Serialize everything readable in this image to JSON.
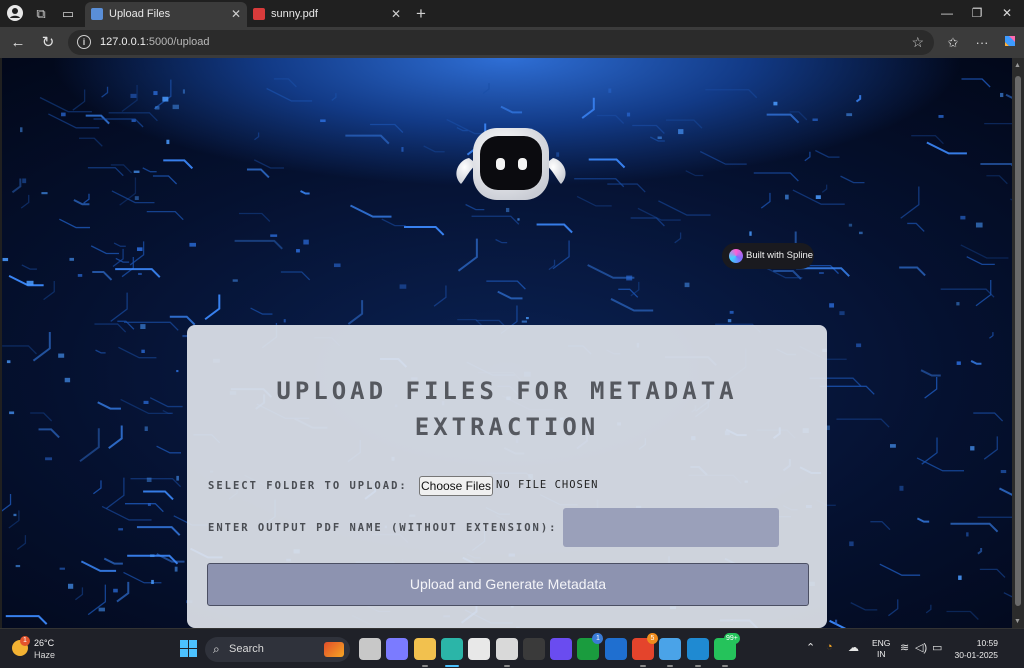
{
  "browser": {
    "tabs": [
      {
        "title": "Upload Files",
        "active": true
      },
      {
        "title": "sunny.pdf",
        "active": false
      }
    ],
    "url": {
      "host": "127.0.0.1",
      "path": ":5000/upload"
    }
  },
  "page": {
    "badge": "Built with Spline",
    "card": {
      "title": "UPLOAD FILES FOR METADATA EXTRACTION",
      "folder_label": "SELECT FOLDER TO UPLOAD:",
      "choose_button": "Choose Files",
      "no_file_text": "NO FILE CHOSEN",
      "pdf_name_label": "ENTER OUTPUT PDF NAME (WITHOUT EXTENSION):",
      "pdf_name_value": "",
      "submit_label": "Upload and Generate Metadata"
    },
    "colors": {
      "accent_glow": "#2f6fd6",
      "card_bg": "#dee2ea",
      "submit_bg": "#8d93b0",
      "input_bg": "#9aa0ba"
    }
  },
  "taskbar": {
    "weather": {
      "temp": "26°C",
      "condition": "Haze",
      "badge": "1"
    },
    "search_placeholder": "Search",
    "apps": [
      {
        "name": "task-view-icon"
      },
      {
        "name": "copilot-icon"
      },
      {
        "name": "file-explorer-icon"
      },
      {
        "name": "edge-icon"
      },
      {
        "name": "microsoft-store-icon"
      },
      {
        "name": "chatgpt-icon"
      },
      {
        "name": "terminal-icon"
      },
      {
        "name": "app-m-icon"
      },
      {
        "name": "xbox-icon",
        "badge": "1"
      },
      {
        "name": "outlook-icon"
      },
      {
        "name": "chrome-icon",
        "badge": "5"
      },
      {
        "name": "notepad-icon"
      },
      {
        "name": "vscode-icon"
      },
      {
        "name": "whatsapp-icon",
        "badge": "99+"
      }
    ],
    "lang_top": "ENG",
    "lang_bottom": "IN",
    "time": "10:59",
    "date": "30-01-2025"
  }
}
